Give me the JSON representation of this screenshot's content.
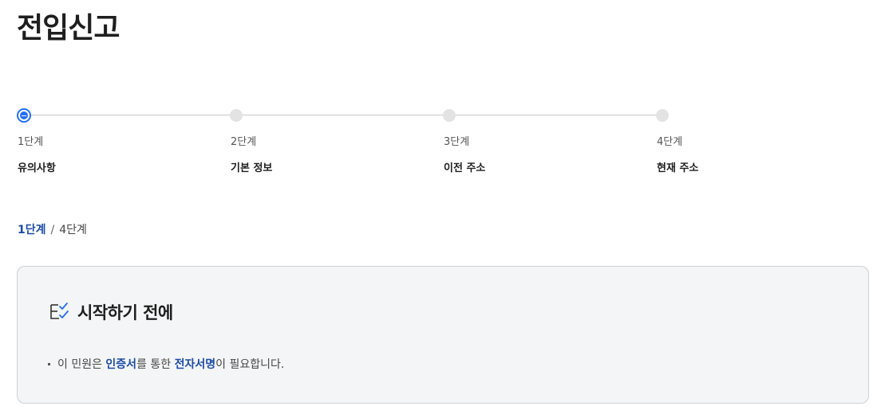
{
  "page": {
    "title": "전입신고"
  },
  "stepper": {
    "current": 1,
    "steps": [
      {
        "num": "1단계",
        "name": "유의사항"
      },
      {
        "num": "2단계",
        "name": "기본 정보"
      },
      {
        "num": "3단계",
        "name": "이전 주소"
      },
      {
        "num": "4단계",
        "name": "현재 주소"
      }
    ]
  },
  "progress": {
    "current": "1단계",
    "separator": "/",
    "total": "4단계"
  },
  "notice": {
    "icon": "checklist-icon",
    "title": "시작하기 전에",
    "item": {
      "part1": "이 민원은 ",
      "highlight1": "인증서",
      "part2": "를 통한 ",
      "highlight2": "전자서명",
      "part3": "이 필요합니다."
    }
  },
  "colors": {
    "accent": "#256ef4",
    "highlight": "#1c4ba8",
    "box_bg": "#f4f5f6"
  }
}
